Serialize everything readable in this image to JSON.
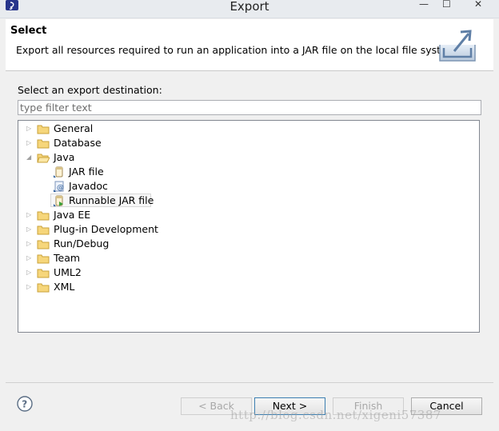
{
  "window": {
    "title": "Export",
    "controls": [
      "—",
      "☐",
      "✕"
    ]
  },
  "header": {
    "title": "Select",
    "description": "Export all resources required to run an application into a JAR file on the local file system."
  },
  "content": {
    "destination_label": "Select an export destination:",
    "filter_placeholder": "type filter text",
    "tree": [
      {
        "label": "General",
        "level": 0,
        "expanded": false,
        "icon": "folder-icon"
      },
      {
        "label": "Database",
        "level": 0,
        "expanded": false,
        "icon": "folder-icon"
      },
      {
        "label": "Java",
        "level": 0,
        "expanded": true,
        "icon": "folder-icon"
      },
      {
        "label": "JAR file",
        "level": 1,
        "icon": "jar-file-icon"
      },
      {
        "label": "Javadoc",
        "level": 1,
        "icon": "javadoc-icon"
      },
      {
        "label": "Runnable JAR file",
        "level": 1,
        "icon": "runnable-jar-icon",
        "selected": true
      },
      {
        "label": "Java EE",
        "level": 0,
        "expanded": false,
        "icon": "folder-icon"
      },
      {
        "label": "Plug-in Development",
        "level": 0,
        "expanded": false,
        "icon": "folder-icon"
      },
      {
        "label": "Run/Debug",
        "level": 0,
        "expanded": false,
        "icon": "folder-icon"
      },
      {
        "label": "Team",
        "level": 0,
        "expanded": false,
        "icon": "folder-icon"
      },
      {
        "label": "UML2",
        "level": 0,
        "expanded": false,
        "icon": "folder-icon"
      },
      {
        "label": "XML",
        "level": 0,
        "expanded": false,
        "icon": "folder-icon"
      }
    ]
  },
  "footer": {
    "back_label": "< Back",
    "next_label": "Next >",
    "finish_label": "Finish",
    "cancel_label": "Cancel"
  },
  "watermark": "http://blog.csdn.net/xigeni57387"
}
